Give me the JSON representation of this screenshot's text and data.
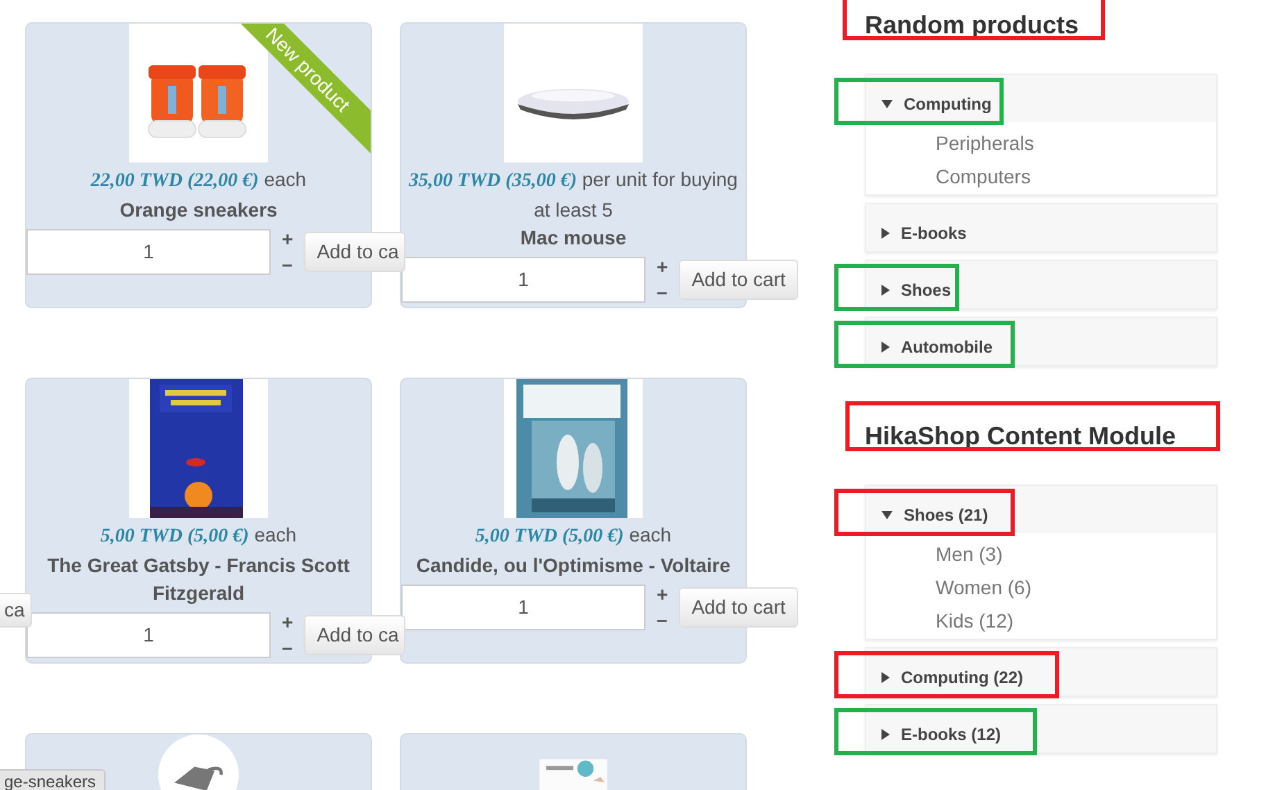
{
  "products": [
    {
      "kind": "item",
      "ribbon": "New product",
      "price": "22,00 TWD (22,00 €)",
      "unit": "each",
      "name": "Orange sneakers",
      "quantity": "1",
      "plus": "+",
      "minus": "–",
      "button": "Add to ca"
    },
    {
      "kind": "item",
      "price": "35,00 TWD (35,00 €)",
      "unit": "per unit for buying at least 5",
      "name": "Mac mouse",
      "quantity": "1",
      "plus": "+",
      "minus": "–",
      "button": "Add to cart"
    },
    {
      "kind": "item",
      "price": "5,00 TWD (5,00 €)",
      "unit": "each",
      "name": "The Great Gatsby - Francis Scott Fitzgerald",
      "quantity": "1",
      "plus": "+",
      "minus": "–",
      "button": "Add to ca"
    },
    {
      "kind": "item",
      "price": "5,00 TWD (5,00 €)",
      "unit": "each",
      "name": "Candide, ou l'Optimisme - Voltaire",
      "quantity": "1",
      "plus": "+",
      "minus": "–",
      "button": "Add to cart"
    },
    {
      "kind": "partial"
    },
    {
      "kind": "partial"
    }
  ],
  "edge_button": "ca",
  "tooltip": "ge-sneakers",
  "modules": [
    {
      "title": "Random products",
      "color": "#ed1c24",
      "categories": [
        {
          "label": "Computing",
          "expanded": true,
          "color": "#22b14c",
          "children": [
            {
              "label": "Peripherals"
            },
            {
              "label": "Computers"
            }
          ]
        },
        {
          "label": "E-books",
          "expanded": false
        },
        {
          "label": "Shoes",
          "expanded": false,
          "color": "#22b14c"
        },
        {
          "label": "Automobile",
          "expanded": false,
          "color": "#22b14c"
        }
      ]
    },
    {
      "title": "HikaShop Content Module",
      "color": "#ed1c24",
      "categories": [
        {
          "label": "Shoes (21)",
          "expanded": true,
          "color": "#ed1c24",
          "children": [
            {
              "label": "Men (3)"
            },
            {
              "label": "Women (6)"
            },
            {
              "label": "Kids (12)"
            }
          ]
        },
        {
          "label": "Computing (22)",
          "expanded": false,
          "color": "#ed1c24"
        },
        {
          "label": "E-books (12)",
          "expanded": false,
          "color": "#22b14c"
        }
      ]
    }
  ]
}
